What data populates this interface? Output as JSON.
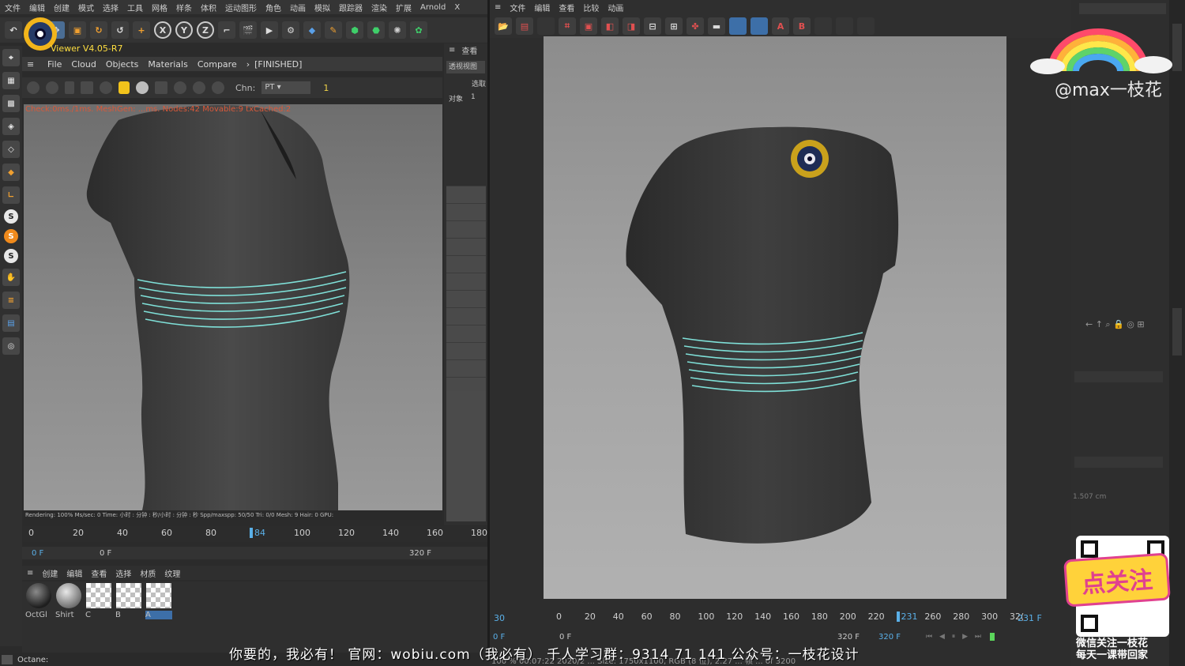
{
  "c4d_menu": [
    "文件",
    "编辑",
    "创建",
    "模式",
    "选择",
    "工具",
    "网格",
    "样条",
    "体积",
    "运动图形",
    "角色",
    "动画",
    "模拟",
    "跟踪器",
    "渲染",
    "扩展",
    "Arnold",
    "X"
  ],
  "toolbar_axes": [
    "X",
    "Y",
    "Z"
  ],
  "octane_viewer": {
    "title": "Viewer V4.05-R7",
    "menu": [
      "File",
      "Cloud",
      "Objects",
      "Materials",
      "Compare"
    ],
    "breadcrumb_sep": "›",
    "status": "[FINISHED]",
    "chn_label": "Chn:",
    "chn_value": "PT",
    "chn_num": "1",
    "overlay_text": "Check:0ms./1ms. MeshGen:    ...ms. Nodes:42 Movable:9 txCached:2",
    "render_status": "Rendering: 100%   Ms/sec: 0   Time: 小时 : 分钟 : 秒/小时 : 分钟 : 秒   Spp/maxspp: 50/50   Tri: 0/0   Mesh: 9   Hair: 0   GPU:   "
  },
  "timeline_left": {
    "ticks": [
      "0",
      "20",
      "40",
      "60",
      "80",
      "84",
      "100",
      "120",
      "140",
      "160",
      "180"
    ],
    "frame_start": "0 F",
    "frame_field": "0 F",
    "frame_end": "320 F"
  },
  "material_menu": [
    "创建",
    "编辑",
    "查看",
    "选择",
    "材质",
    "纹理"
  ],
  "materials": [
    {
      "label": "OctGl",
      "kind": "dark"
    },
    {
      "label": "Shirt",
      "kind": "grey"
    },
    {
      "label": "C",
      "kind": "checker"
    },
    {
      "label": "B",
      "kind": "checker"
    },
    {
      "label": "A",
      "kind": "checker"
    }
  ],
  "mid_panel": {
    "tab": "查看",
    "label1": "透视视图",
    "label2": "选取",
    "label3": "对象",
    "value3": "1"
  },
  "picture_viewer": {
    "menu": [
      "文件",
      "编辑",
      "查看",
      "比较",
      "动画"
    ],
    "ruler_ticks": [
      "0",
      "20",
      "40",
      "60",
      "80",
      "100",
      "120",
      "140",
      "160",
      "180",
      "200",
      "220",
      "231",
      "260",
      "280",
      "300",
      "32("
    ],
    "left_frame": "30",
    "current_frame": "231 F",
    "frame_start": "0 F",
    "frame_field": "0 F",
    "frame_end": "320 F",
    "frame_end2": "320 F",
    "info_line": "100 %   00:07:22  2020/2 ... Size: 1750x1100, RGB (8 位), 2.27 ... 帧 ... of 3200"
  },
  "subtitle": "你要的，我必有！  官网：wobiu.com（我必有）  千人学习群：9314 71 141   公众号：一枝花设计",
  "bottom_status": "Octane:",
  "watermark": "@max一枝花",
  "promo": {
    "sticker": "点关注",
    "caption_line1": "微信关注一枝花",
    "caption_line2": "每天一课带回家"
  },
  "right_panel": {
    "value1": "1.507 cm"
  },
  "colors": {
    "accent_blue": "#3d8bd9",
    "stripe_cyan": "#7fe0d8",
    "shirt": "#3d3d3d",
    "timeline_green": "#5bd65b"
  }
}
